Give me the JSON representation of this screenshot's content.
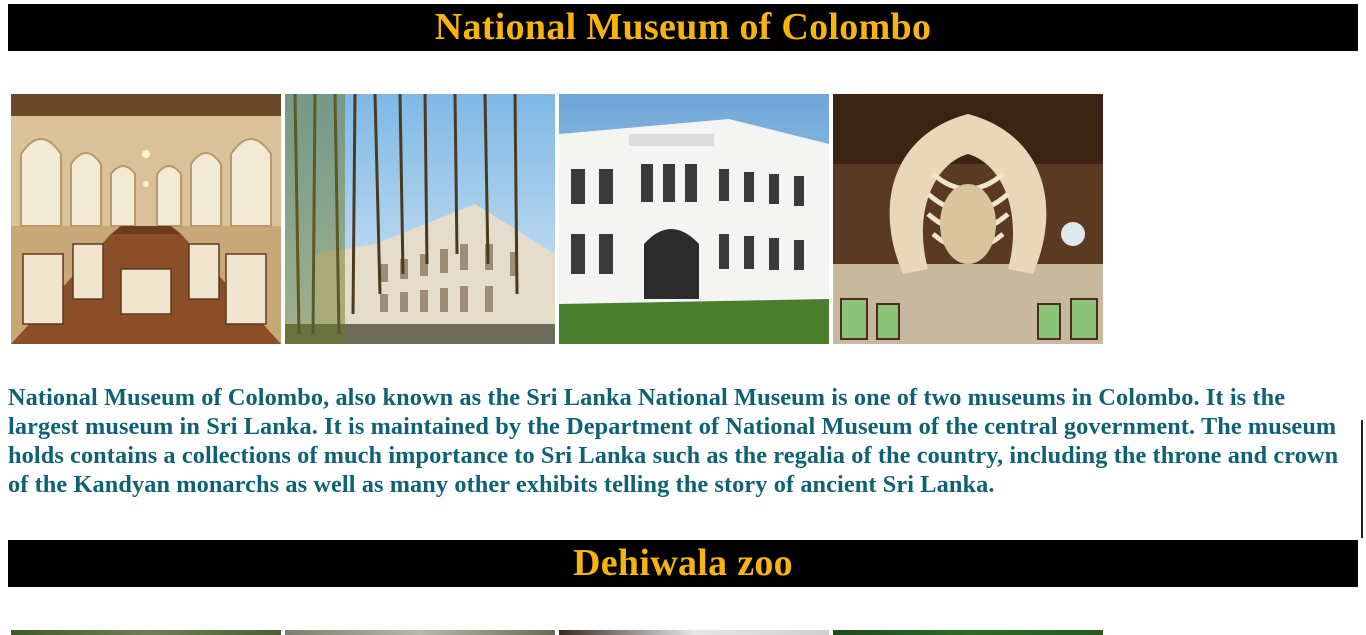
{
  "sections": [
    {
      "title": "National Museum of Colombo",
      "photos": [
        "museum-interior-gallery",
        "museum-facade-with-banyan",
        "museum-white-building",
        "whale-skeleton-exhibit"
      ],
      "description": "National Museum of Colombo, also known as the Sri Lanka National Museum is one of two museums in Colombo. It is the largest museum in Sri Lanka. It is maintained by the Department of National Museum of the central government. The museum holds contains a collections of much importance to Sri Lanka such as the regalia of the country, including the throne and crown of the Kandyan monarchs as well as many other exhibits telling the story of ancient Sri Lanka."
    },
    {
      "title": "Dehiwala zoo",
      "photos": [
        "zoo-photo-1",
        "zoo-photo-2",
        "zoo-photo-3",
        "zoo-photo-4"
      ]
    }
  ],
  "colors": {
    "heading_bg": "#000000",
    "heading_text": "#f7b40f",
    "description_text": "#0f6273"
  }
}
